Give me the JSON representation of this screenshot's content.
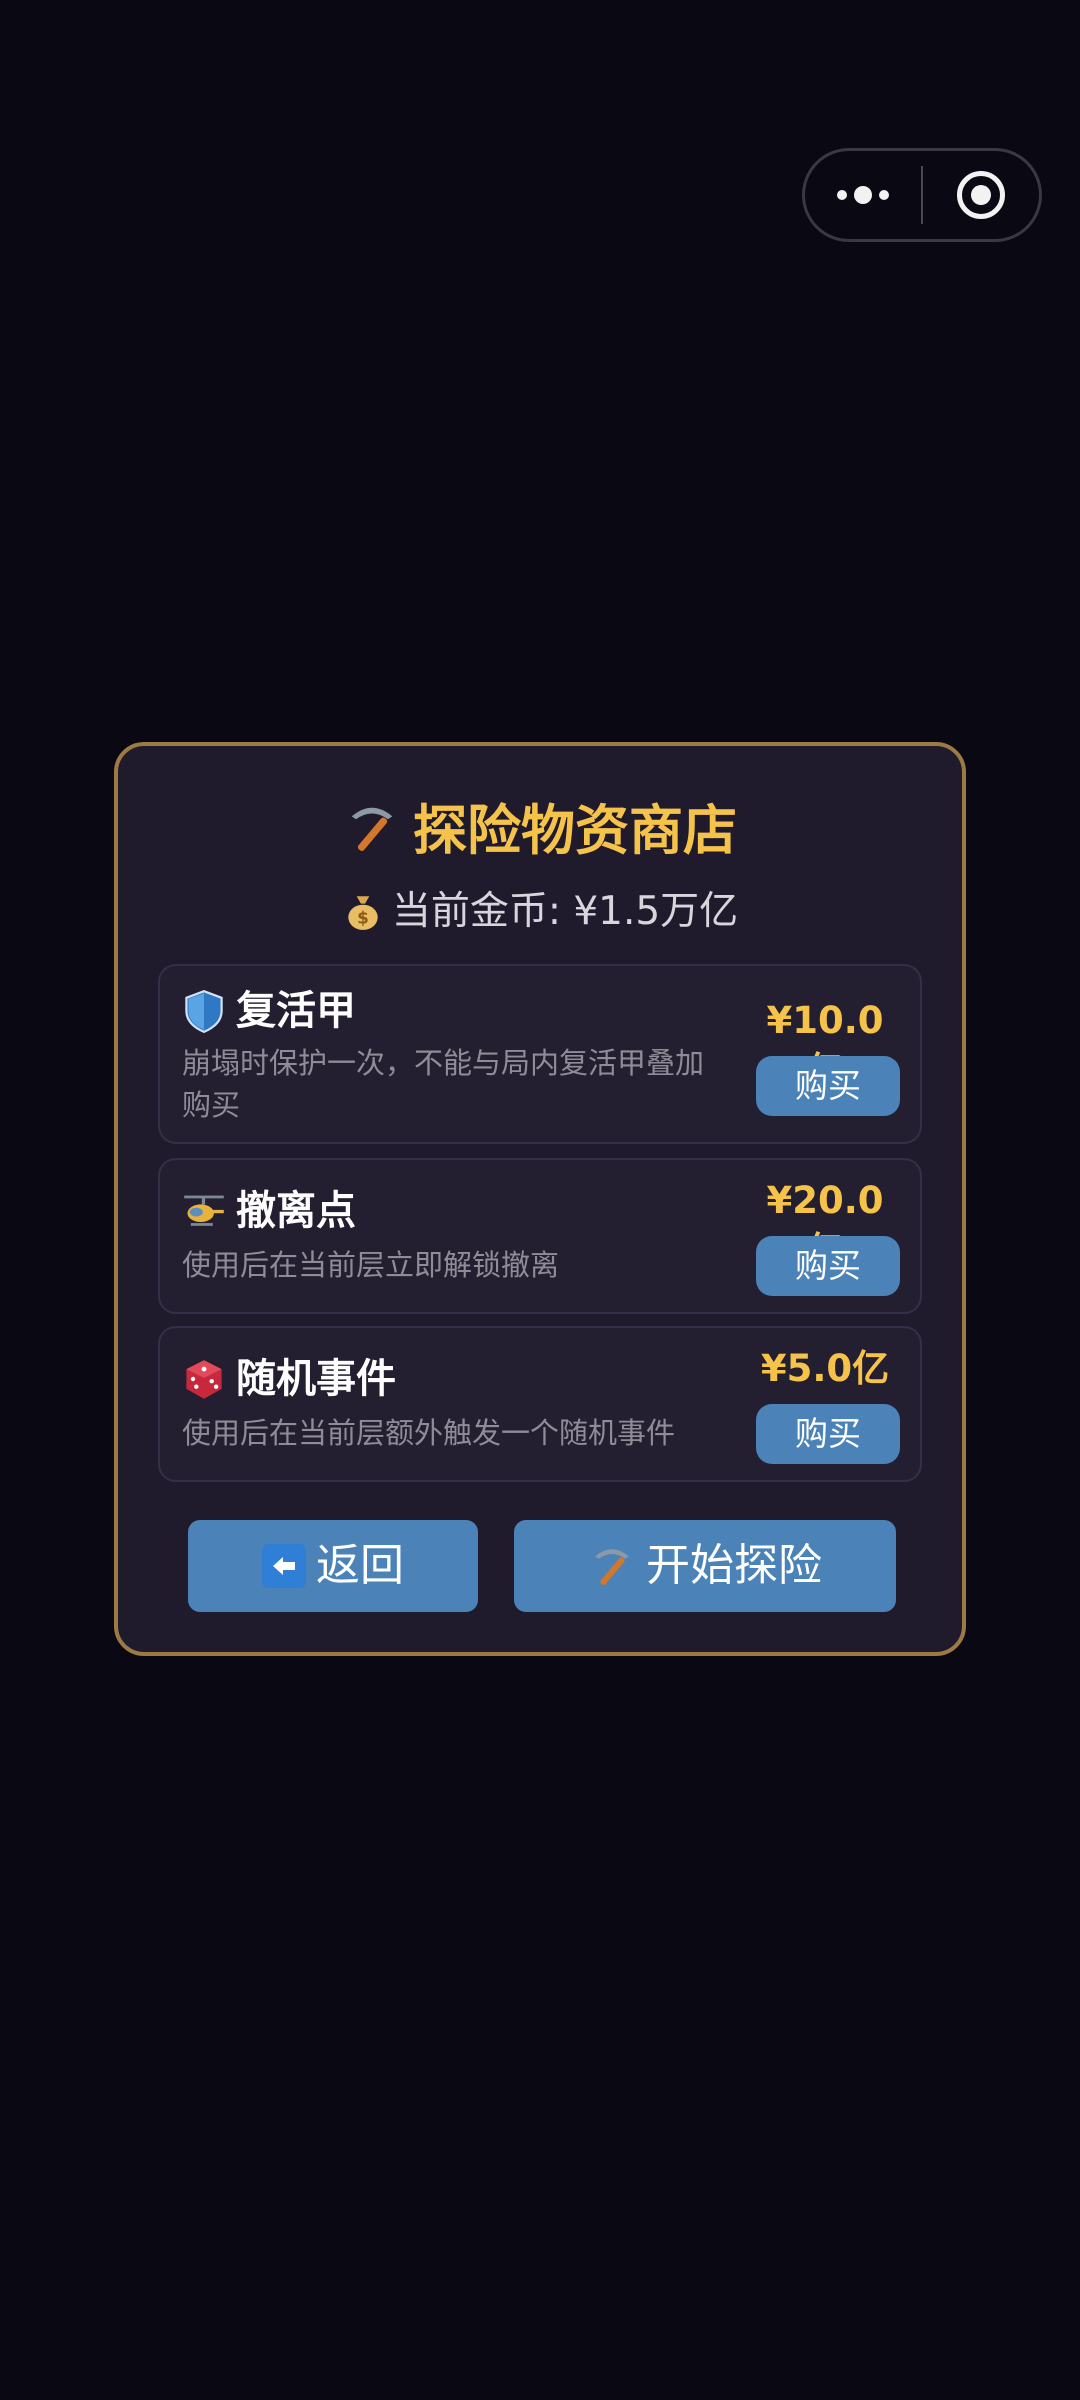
{
  "capsule": {
    "more_icon": "more-dots-icon",
    "close_icon": "target-close-icon"
  },
  "shop": {
    "title": "探险物资商店",
    "title_icon": "pickaxe-icon",
    "coins_icon": "money-bag-icon",
    "coins_text": "当前金币: ¥1.5万亿",
    "items": [
      {
        "icon": "shield-icon",
        "name": "复活甲",
        "desc_line1": "崩塌时保护一次，不能与局内复活甲叠加",
        "desc_line2": "购买",
        "price": "¥10.0亿",
        "buy_label": "购买"
      },
      {
        "icon": "helicopter-icon",
        "name": "撤离点",
        "desc_line1": "使用后在当前层立即解锁撤离",
        "desc_line2": "",
        "price": "¥20.0亿",
        "buy_label": "购买"
      },
      {
        "icon": "dice-icon",
        "name": "随机事件",
        "desc_line1": "使用后在当前层额外触发一个随机事件",
        "desc_line2": "",
        "price": "¥5.0亿",
        "buy_label": "购买"
      }
    ],
    "back_label": "返回",
    "back_icon": "left-arrow-icon",
    "start_label": "开始探险",
    "start_icon": "pickaxe-icon"
  },
  "colors": {
    "accent_gold": "#f6c34a",
    "button_blue": "#4b83b8",
    "dialog_bg": "#1f1b2c",
    "border_gold": "#9c7a44"
  }
}
